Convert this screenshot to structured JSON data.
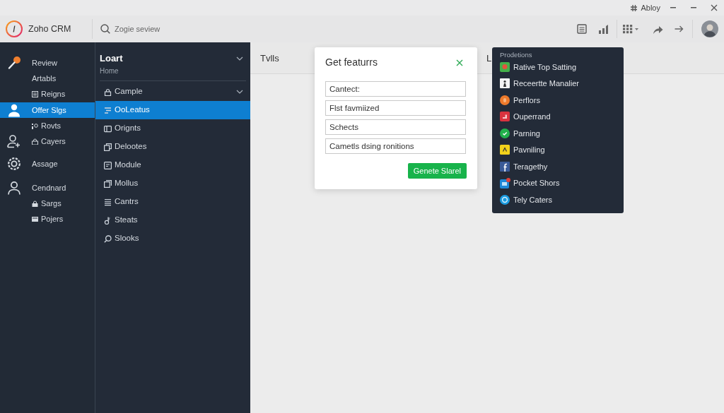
{
  "title_bar": {
    "account": "Abloy"
  },
  "app_bar": {
    "app_name": "Zoho CRM",
    "search": {
      "placeholder": "Zogie seview"
    }
  },
  "sidebar": {
    "items": [
      {
        "label": "Review",
        "kind": "main",
        "selected": false
      },
      {
        "label": "Artabls",
        "kind": "plain",
        "selected": false
      },
      {
        "label": "Reigns",
        "kind": "sub",
        "selected": false
      },
      {
        "label": "Offer Slgs",
        "kind": "main",
        "selected": true
      },
      {
        "label": "Rovts",
        "kind": "sub",
        "selected": false
      },
      {
        "label": "Cayers",
        "kind": "group",
        "selected": false
      },
      {
        "label": "Assage",
        "kind": "main",
        "selected": false
      },
      {
        "label": "Cendnard",
        "kind": "main",
        "selected": false
      },
      {
        "label": "Sargs",
        "kind": "sub",
        "selected": false
      },
      {
        "label": "Pojers",
        "kind": "sub",
        "selected": false
      }
    ]
  },
  "nav_panel": {
    "title": "Loart",
    "subtitle": "Home",
    "items": [
      {
        "label": "Cample",
        "selected": false,
        "expandable": true
      },
      {
        "label": "OoLeatus",
        "selected": true,
        "expandable": false
      },
      {
        "label": "Orignts",
        "selected": false,
        "expandable": false
      },
      {
        "label": "Delootes",
        "selected": false,
        "expandable": false
      },
      {
        "label": "Module",
        "selected": false,
        "expandable": false
      },
      {
        "label": "Mollus",
        "selected": false,
        "expandable": false
      },
      {
        "label": "Cantrs",
        "selected": false,
        "expandable": false
      },
      {
        "label": "Steats",
        "selected": false,
        "expandable": false
      },
      {
        "label": "Slooks",
        "selected": false,
        "expandable": false
      }
    ]
  },
  "main": {
    "columns": [
      "Tvlls",
      "L"
    ]
  },
  "dialog": {
    "title": "Get featurrs",
    "fields": [
      {
        "value": "Cantect:"
      },
      {
        "value": "Flst favmiized"
      },
      {
        "value": "Schects"
      },
      {
        "value": "Cametls dsing ronitions"
      }
    ],
    "button": "Genete Slarel"
  },
  "dropdown": {
    "heading": "Prodetions",
    "items": [
      {
        "label": "Rative Top Satting"
      },
      {
        "label": "Receertte Manalier"
      },
      {
        "label": "Perflors"
      },
      {
        "label": "Ouperrand"
      },
      {
        "label": "Parning"
      },
      {
        "label": "Pavniling"
      },
      {
        "label": "Teragethy"
      },
      {
        "label": "Pocket Shors"
      },
      {
        "label": "Tely Caters"
      }
    ]
  }
}
